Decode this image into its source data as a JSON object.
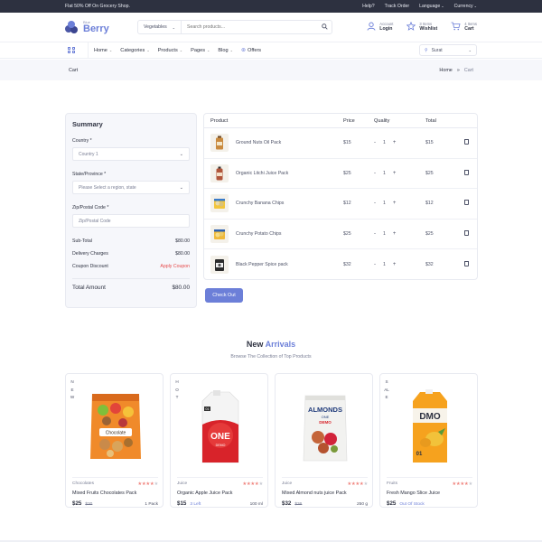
{
  "topbar": {
    "promo": "Flat 50% Off On Grocery Shop.",
    "help": "Help?",
    "track": "Track Order",
    "language": "Language",
    "currency": "Currency"
  },
  "header": {
    "logo_small": "Blue",
    "logo_name": "Berry",
    "search_category": "Vegetables",
    "search_placeholder": "Search products...",
    "account_small": "Account",
    "account_label": "Login",
    "wishlist_small": "3 Items",
    "wishlist_label": "Wishlist",
    "cart_small": "4 Items",
    "cart_label": "Cart"
  },
  "nav": {
    "home": "Home",
    "categories": "Categories",
    "products": "Products",
    "pages": "Pages",
    "blog": "Blog",
    "offers": "Offers",
    "location": "Surat"
  },
  "breadcrumb": {
    "title": "Cart",
    "home": "Home",
    "sep": "»",
    "current": "Cart"
  },
  "summary": {
    "title": "Summary",
    "country_label": "Country *",
    "country_value": "Country 1",
    "state_label": "State/Province *",
    "state_value": "Please Select a region, state",
    "zip_label": "Zip/Postal Code *",
    "zip_placeholder": "Zip/Postal Code",
    "subtotal_label": "Sub-Total",
    "subtotal_value": "$80.00",
    "delivery_label": "Delivery Charges",
    "delivery_value": "$80.00",
    "coupon_label": "Coupon Discount",
    "coupon_value": "Apply Coupon",
    "total_label": "Total Amount",
    "total_value": "$80.00"
  },
  "cart": {
    "headers": {
      "product": "Product",
      "price": "Price",
      "quantity": "Quality",
      "total": "Total"
    },
    "items": [
      {
        "name": "Ground Nuts Oil Pack",
        "price": "$15",
        "qty": "1",
        "total": "$15"
      },
      {
        "name": "Organic Litchi Juice Pack",
        "price": "$25",
        "qty": "1",
        "total": "$25"
      },
      {
        "name": "Crunchy Banana Chips",
        "price": "$12",
        "qty": "1",
        "total": "$12"
      },
      {
        "name": "Crunchy Potato Chips",
        "price": "$25",
        "qty": "1",
        "total": "$25"
      },
      {
        "name": "Black Pepper Spice pack",
        "price": "$32",
        "qty": "1",
        "total": "$32"
      }
    ],
    "minus": "-",
    "plus": "+",
    "checkout": "Check Out"
  },
  "arrivals": {
    "title_plain": "New",
    "title_accent": "Arrivals",
    "subtitle": "Browse The Collection of Top Products",
    "cards": [
      {
        "tag": "NEW",
        "category": "Chocolates",
        "name": "Mixed Fruits Chocolates Pack",
        "price": "$25",
        "old_price": "$30",
        "stock": "",
        "unit": "1 Pack",
        "rating": 4,
        "pack_text": "Chocolate"
      },
      {
        "tag": "HOT",
        "category": "Juice",
        "name": "Organic Apple Juice Pack",
        "price": "$15",
        "old_price": "",
        "stock": "3 Left",
        "unit": "100 ml",
        "rating": 4,
        "pack_text": "ONE",
        "pack_sub": "DEMO",
        "pack_badge": "01"
      },
      {
        "tag": "",
        "category": "Juice",
        "name": "Mixed Almond nuts juice Pack",
        "price": "$32",
        "old_price": "$36",
        "stock": "",
        "unit": "250 g",
        "rating": 4,
        "pack_text": "ALMONDS",
        "pack_sub": "ONE",
        "pack_sub2": "DEMO"
      },
      {
        "tag": "SALE",
        "category": "Fruits",
        "name": "Fresh Mango Slice Juice",
        "price": "$25",
        "old_price": "",
        "stock": "Out Of Stock",
        "unit": "",
        "rating": 4,
        "pack_text": "DMO",
        "pack_badge": "01"
      }
    ]
  },
  "colors": {
    "accent": "#6c7fd8",
    "topbar": "#2d3140",
    "coupon": "#e64848",
    "star": "#f0857f"
  }
}
